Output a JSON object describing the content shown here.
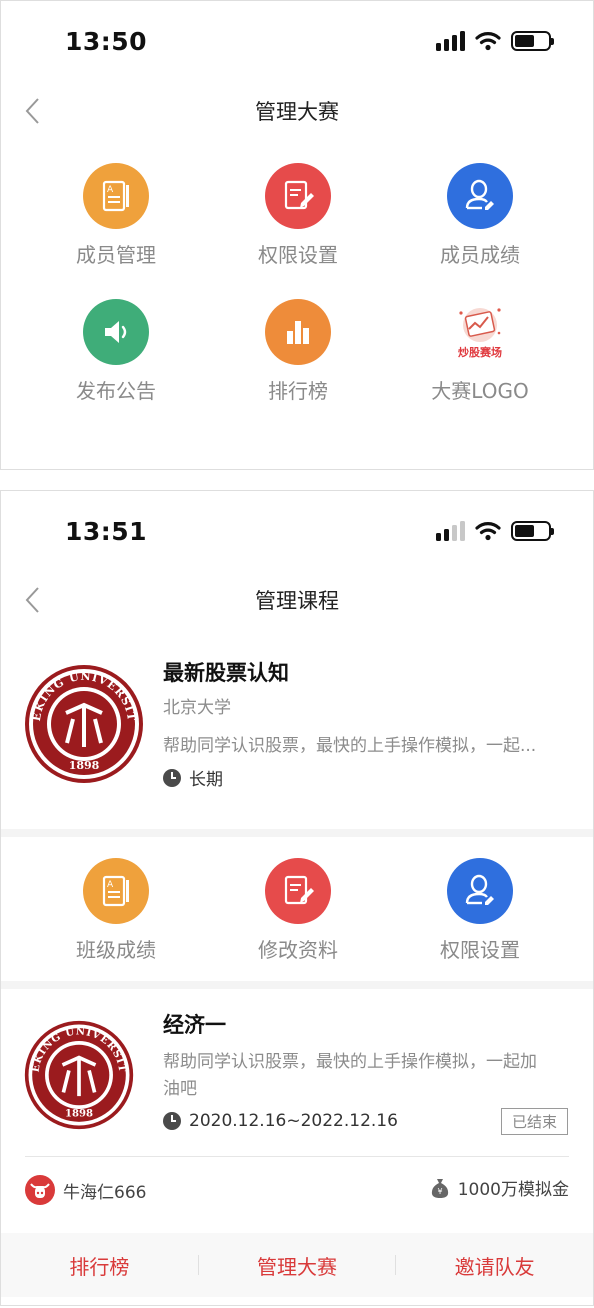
{
  "screen1": {
    "status": {
      "time": "13:50"
    },
    "nav": {
      "title": "管理大赛"
    },
    "grid": [
      {
        "label": "成员管理",
        "icon": "notebook-icon",
        "color": "#efa13c"
      },
      {
        "label": "权限设置",
        "icon": "edit-document-icon",
        "color": "#e64b4b"
      },
      {
        "label": "成员成绩",
        "icon": "user-icon",
        "color": "#2f6fde"
      },
      {
        "label": "发布公告",
        "icon": "speaker-icon",
        "color": "#3fad79"
      },
      {
        "label": "排行榜",
        "icon": "bar-chart-icon",
        "color": "#ee8c3a"
      },
      {
        "label": "大赛LOGO",
        "icon": "contest-logo-icon",
        "logo_text": "炒股赛场"
      }
    ]
  },
  "screen2": {
    "status": {
      "time": "13:51"
    },
    "nav": {
      "title": "管理课程"
    },
    "course": {
      "title": "最新股票认知",
      "school": "北京大学",
      "desc": "帮助同学认识股票，最快的上手操作模拟，一起...",
      "duration": "长期"
    },
    "grid": [
      {
        "label": "班级成绩",
        "icon": "notebook-icon"
      },
      {
        "label": "修改资料",
        "icon": "edit-document-icon"
      },
      {
        "label": "权限设置",
        "icon": "user-icon"
      }
    ],
    "contest": {
      "title": "经济一",
      "desc_line1": "帮助同学认识股票，最快的上手操作模拟，一起加",
      "desc_line2": "油吧",
      "period": "2020.12.16~2022.12.16",
      "status": "已结束",
      "owner": "牛海仁666",
      "fund": "1000万模拟金"
    },
    "bottom_tabs": [
      "排行榜",
      "管理大赛",
      "邀请队友"
    ]
  },
  "university_logo": {
    "name": "PEKING UNIVERSITY",
    "year": "1898"
  },
  "colors": {
    "accent_red": "#d93a3a",
    "logo_red": "#9b1b1e"
  }
}
